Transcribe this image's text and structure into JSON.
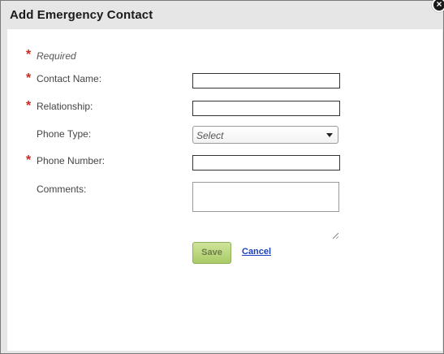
{
  "dialog": {
    "title": "Add Emergency Contact",
    "close_glyph": "×"
  },
  "form": {
    "required_marker": "*",
    "required_note": "Required",
    "fields": {
      "contact_name": {
        "label": "Contact Name:",
        "value": "",
        "required": true
      },
      "relationship": {
        "label": "Relationship:",
        "value": "",
        "required": true
      },
      "phone_type": {
        "label": "Phone Type:",
        "selected": "Select",
        "required": false
      },
      "phone_number": {
        "label": "Phone Number:",
        "value": "",
        "required": true
      },
      "comments": {
        "label": "Comments:",
        "value": "",
        "required": false
      }
    }
  },
  "actions": {
    "save_label": "Save",
    "cancel_label": "Cancel"
  },
  "colors": {
    "required_star": "#cc2a1f",
    "save_button_top": "#cfe39a",
    "save_button_bottom": "#a9cb66",
    "cancel_link": "#1a3fbf",
    "title_bar": "#e6e6e6"
  },
  "icons": {
    "close": "close-icon",
    "dropdown": "chevron-down-icon",
    "resize": "resize-grip-icon"
  }
}
